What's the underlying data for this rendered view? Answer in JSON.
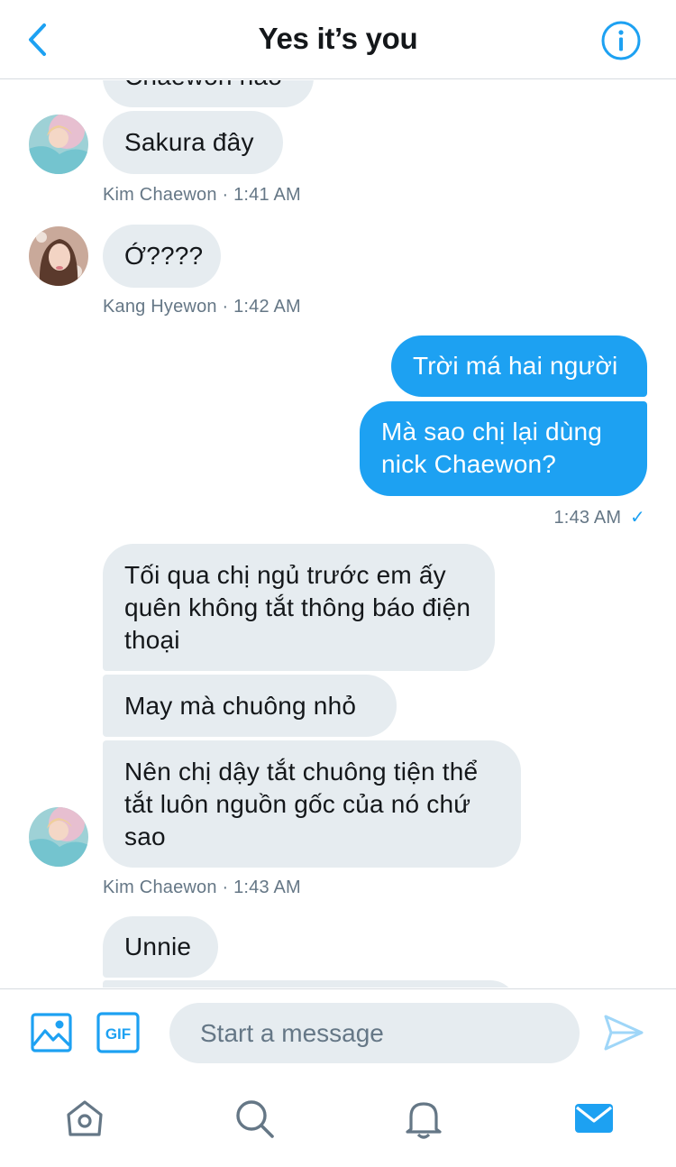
{
  "header": {
    "title": "Yes it’s you"
  },
  "messages": [
    {
      "text": "Chaewon nào"
    },
    {
      "text": "Sakura đây",
      "meta": "Kim Chaewon · 1:41 AM"
    },
    {
      "text": "Ớ????",
      "meta": "Kang Hyewon · 1:42 AM"
    },
    {
      "text": "Trời má hai người"
    },
    {
      "text": "Mà sao chị lại dùng nick Chaewon?",
      "meta": "1:43 AM",
      "status": "✓"
    },
    {
      "text": "Tối qua chị ngủ trước em ấy quên không tắt thông báo điện thoại"
    },
    {
      "text": "May mà chuông nhỏ"
    },
    {
      "text": "Nên chị dậy tắt chuông tiện thể tắt luôn nguồn gốc của nó chứ sao",
      "meta": "Kim Chaewon · 1:43 AM"
    },
    {
      "text": "Unnie"
    }
  ],
  "composer": {
    "placeholder": "Start a message"
  },
  "colors": {
    "accent": "#1da1f2",
    "incoming": "#e6ecf0",
    "meta": "#657786",
    "icon": "#657786"
  },
  "icons": [
    "back-chevron",
    "info",
    "image",
    "gif",
    "send",
    "home",
    "search",
    "bell",
    "mail"
  ]
}
